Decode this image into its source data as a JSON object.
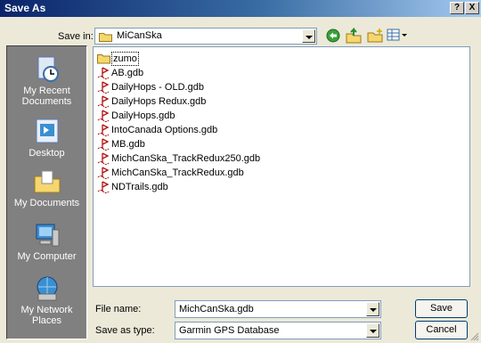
{
  "window": {
    "title": "Save As",
    "help_label": "?",
    "close_label": "X"
  },
  "toolbar": {
    "save_in_label": "Save in:",
    "save_in_value": "MiCanSka",
    "back_icon": "back-arrow-icon",
    "up_icon": "up-folder-icon",
    "new_folder_icon": "new-folder-icon",
    "views_icon": "views-menu-icon"
  },
  "places": [
    {
      "label": "My Recent Documents",
      "icon": "recent-documents-icon"
    },
    {
      "label": "Desktop",
      "icon": "desktop-icon"
    },
    {
      "label": "My Documents",
      "icon": "my-documents-icon"
    },
    {
      "label": "My Computer",
      "icon": "my-computer-icon"
    },
    {
      "label": "My Network Places",
      "icon": "network-places-icon"
    }
  ],
  "files": [
    {
      "name": "zumo",
      "type": "folder"
    },
    {
      "name": "AB.gdb",
      "type": "gdb"
    },
    {
      "name": "DailyHops - OLD.gdb",
      "type": "gdb"
    },
    {
      "name": "DailyHops Redux.gdb",
      "type": "gdb"
    },
    {
      "name": "DailyHops.gdb",
      "type": "gdb"
    },
    {
      "name": "IntoCanada Options.gdb",
      "type": "gdb"
    },
    {
      "name": "MB.gdb",
      "type": "gdb"
    },
    {
      "name": "MichCanSka_TrackRedux250.gdb",
      "type": "gdb"
    },
    {
      "name": "MichCanSka_TrackRedux.gdb",
      "type": "gdb"
    },
    {
      "name": "NDTrails.gdb",
      "type": "gdb"
    }
  ],
  "form": {
    "file_name_label": "File name:",
    "file_name_value": "MichCanSka.gdb",
    "save_as_type_label": "Save as type:",
    "save_as_type_value": "Garmin GPS Database",
    "save_button": "Save",
    "cancel_button": "Cancel"
  },
  "colors": {
    "title_start": "#0a246a",
    "title_end": "#a6caf0",
    "dialog_bg": "#ece9d8",
    "places_bg": "#808080",
    "folder_yellow": "#f5d76e"
  }
}
